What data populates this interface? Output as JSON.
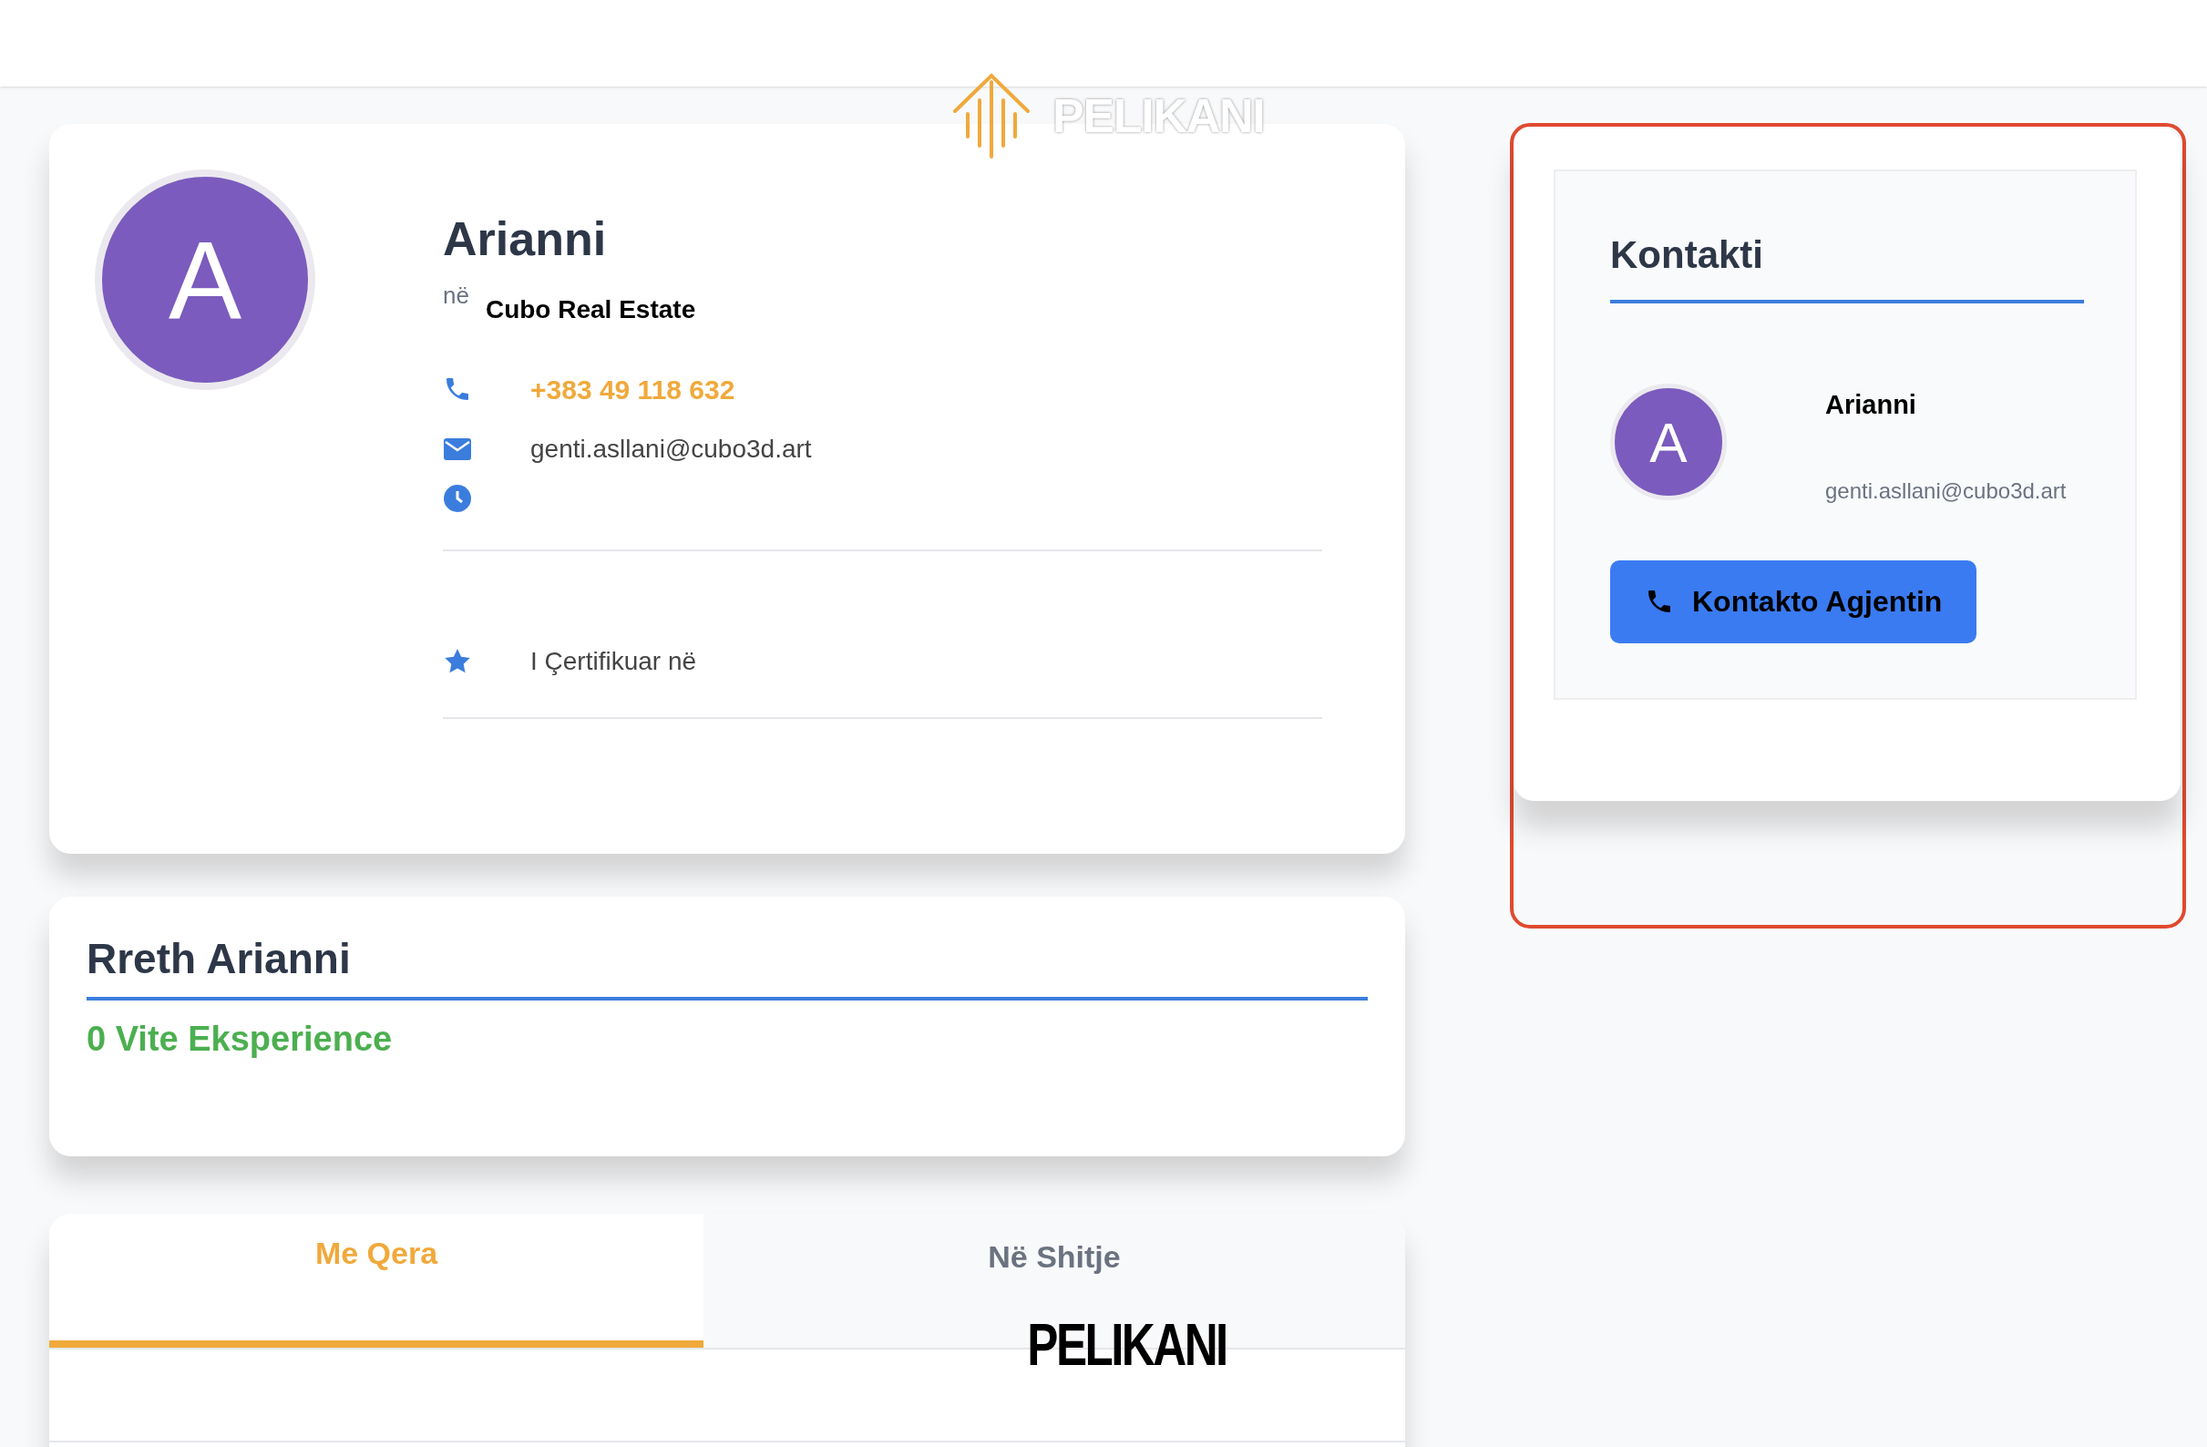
{
  "header": {
    "logo_text": "PELIKANI"
  },
  "profile": {
    "avatar_letter": "A",
    "name": "Arianni",
    "company_prefix": "në",
    "company": "Cubo Real Estate",
    "phone": "+383 49 118 632",
    "email": "genti.asllani@cubo3d.art",
    "certified_label": "I Çertifikuar në"
  },
  "about": {
    "title": "Rreth Arianni",
    "experience": "0 Vite Eksperience"
  },
  "tabs": [
    {
      "label": "Me Qera",
      "selected": true
    },
    {
      "label": "Në Shitje",
      "selected": false
    }
  ],
  "tab_overlay_text": "PELIKANI",
  "contact": {
    "title": "Kontakti",
    "avatar_letter": "A",
    "name": "Arianni",
    "email": "genti.asllani@cubo3d.art",
    "button": "Kontakto Agjentin"
  }
}
